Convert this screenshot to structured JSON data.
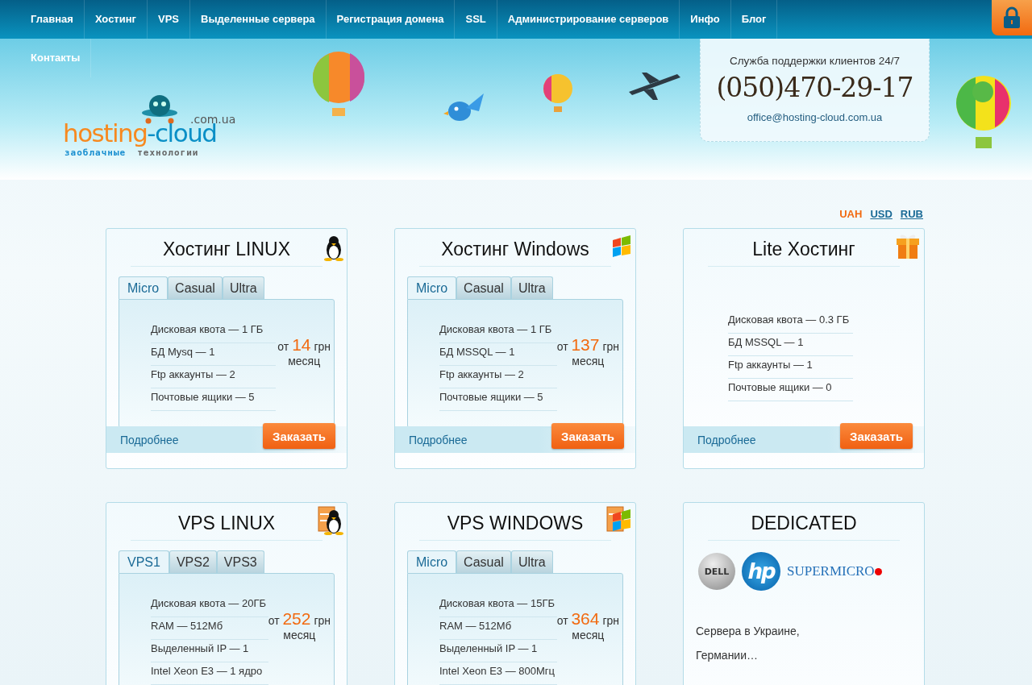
{
  "nav": {
    "items": [
      {
        "label": "Главная"
      },
      {
        "label": "Хостинг"
      },
      {
        "label": "VPS"
      },
      {
        "label": "Выделенные сервера"
      },
      {
        "label": "Регистрация домена"
      },
      {
        "label": "SSL"
      },
      {
        "label": "Администрирование серверов"
      },
      {
        "label": "Инфо"
      },
      {
        "label": "Блог"
      },
      {
        "label": "Контакты"
      }
    ]
  },
  "logo": {
    "name_a": "hosting",
    "name_b": "-cloud",
    "domain": ".com.ua",
    "tagline_a": "заоблачные",
    "tagline_b": "технологии"
  },
  "support": {
    "title": "Служба поддержки клиентов 24/7",
    "phone": "(050)470-29-17",
    "email": "office@hosting-cloud.com.ua"
  },
  "currencies": [
    {
      "label": "UAH",
      "selected": true
    },
    {
      "label": "USD",
      "selected": false
    },
    {
      "label": "RUB",
      "selected": false
    }
  ],
  "cards": [
    {
      "kind": "linux-hosting",
      "title": "Хостинг LINUX",
      "tabs": [
        {
          "label": "Micro",
          "selected": true
        },
        {
          "label": "Casual",
          "selected": false
        },
        {
          "label": "Ultra",
          "selected": false
        }
      ],
      "features": [
        "Дисковая квота — 1 ГБ",
        "БД Mysq — 1",
        "Ftp аккаунты — 2",
        "Почтовые ящики — 5"
      ],
      "price": {
        "from": "от",
        "amount": "14",
        "currency": "грн",
        "period": "месяц"
      },
      "more": "Подробнее",
      "order": "Заказать"
    },
    {
      "kind": "windows-hosting",
      "title": "Хостинг Windows",
      "tabs": [
        {
          "label": "Micro",
          "selected": true
        },
        {
          "label": "Casual",
          "selected": false
        },
        {
          "label": "Ultra",
          "selected": false
        }
      ],
      "features": [
        "Дисковая квота — 1 ГБ",
        "БД MSSQL — 1",
        "Ftp аккаунты — 2",
        "Почтовые ящики — 5"
      ],
      "price": {
        "from": "от",
        "amount": "137",
        "currency": "грн",
        "period": "месяц"
      },
      "more": "Подробнее",
      "order": "Заказать"
    },
    {
      "kind": "lite-hosting",
      "title": "Lite Хостинг",
      "features": [
        "Дисковая квота — 0.3 ГБ",
        "БД MSSQL — 1",
        "Ftp аккаунты — 1",
        "Почтовые ящики — 0"
      ],
      "more": "Подробнее",
      "order": "Заказать"
    },
    {
      "kind": "linux-vps",
      "title": "VPS LINUX",
      "tabs": [
        {
          "label": "VPS1",
          "selected": true
        },
        {
          "label": "VPS2",
          "selected": false
        },
        {
          "label": "VPS3",
          "selected": false
        }
      ],
      "features": [
        "Дисковая квота — 20ГБ",
        "RAM — 512Мб",
        "Выделенный IP — 1",
        "Intel Xeon E3 — 1 ядро"
      ],
      "price": {
        "from": "от",
        "amount": "252",
        "currency": "грн",
        "period": "месяц"
      }
    },
    {
      "kind": "windows-vps",
      "title": "VPS WINDOWS",
      "tabs": [
        {
          "label": "Micro",
          "selected": true
        },
        {
          "label": "Casual",
          "selected": false
        },
        {
          "label": "Ultra",
          "selected": false
        }
      ],
      "features": [
        "Дисковая квота — 15ГБ",
        "RAM — 512Мб",
        "Выделенный IP — 1",
        "Intel Xeon E3 — 800Мгц"
      ],
      "price": {
        "from": "от",
        "amount": "364",
        "currency": "грн",
        "period": "месяц"
      }
    },
    {
      "kind": "dedicated",
      "title": "DEDICATED",
      "vendors": [
        {
          "kind": "dell",
          "label": "DELL"
        },
        {
          "kind": "hp",
          "label": "hp"
        },
        {
          "kind": "supermicro",
          "label": "SUPERMICRO"
        }
      ],
      "lines": [
        "Сервера в Украине,",
        "Германии…"
      ]
    }
  ]
}
